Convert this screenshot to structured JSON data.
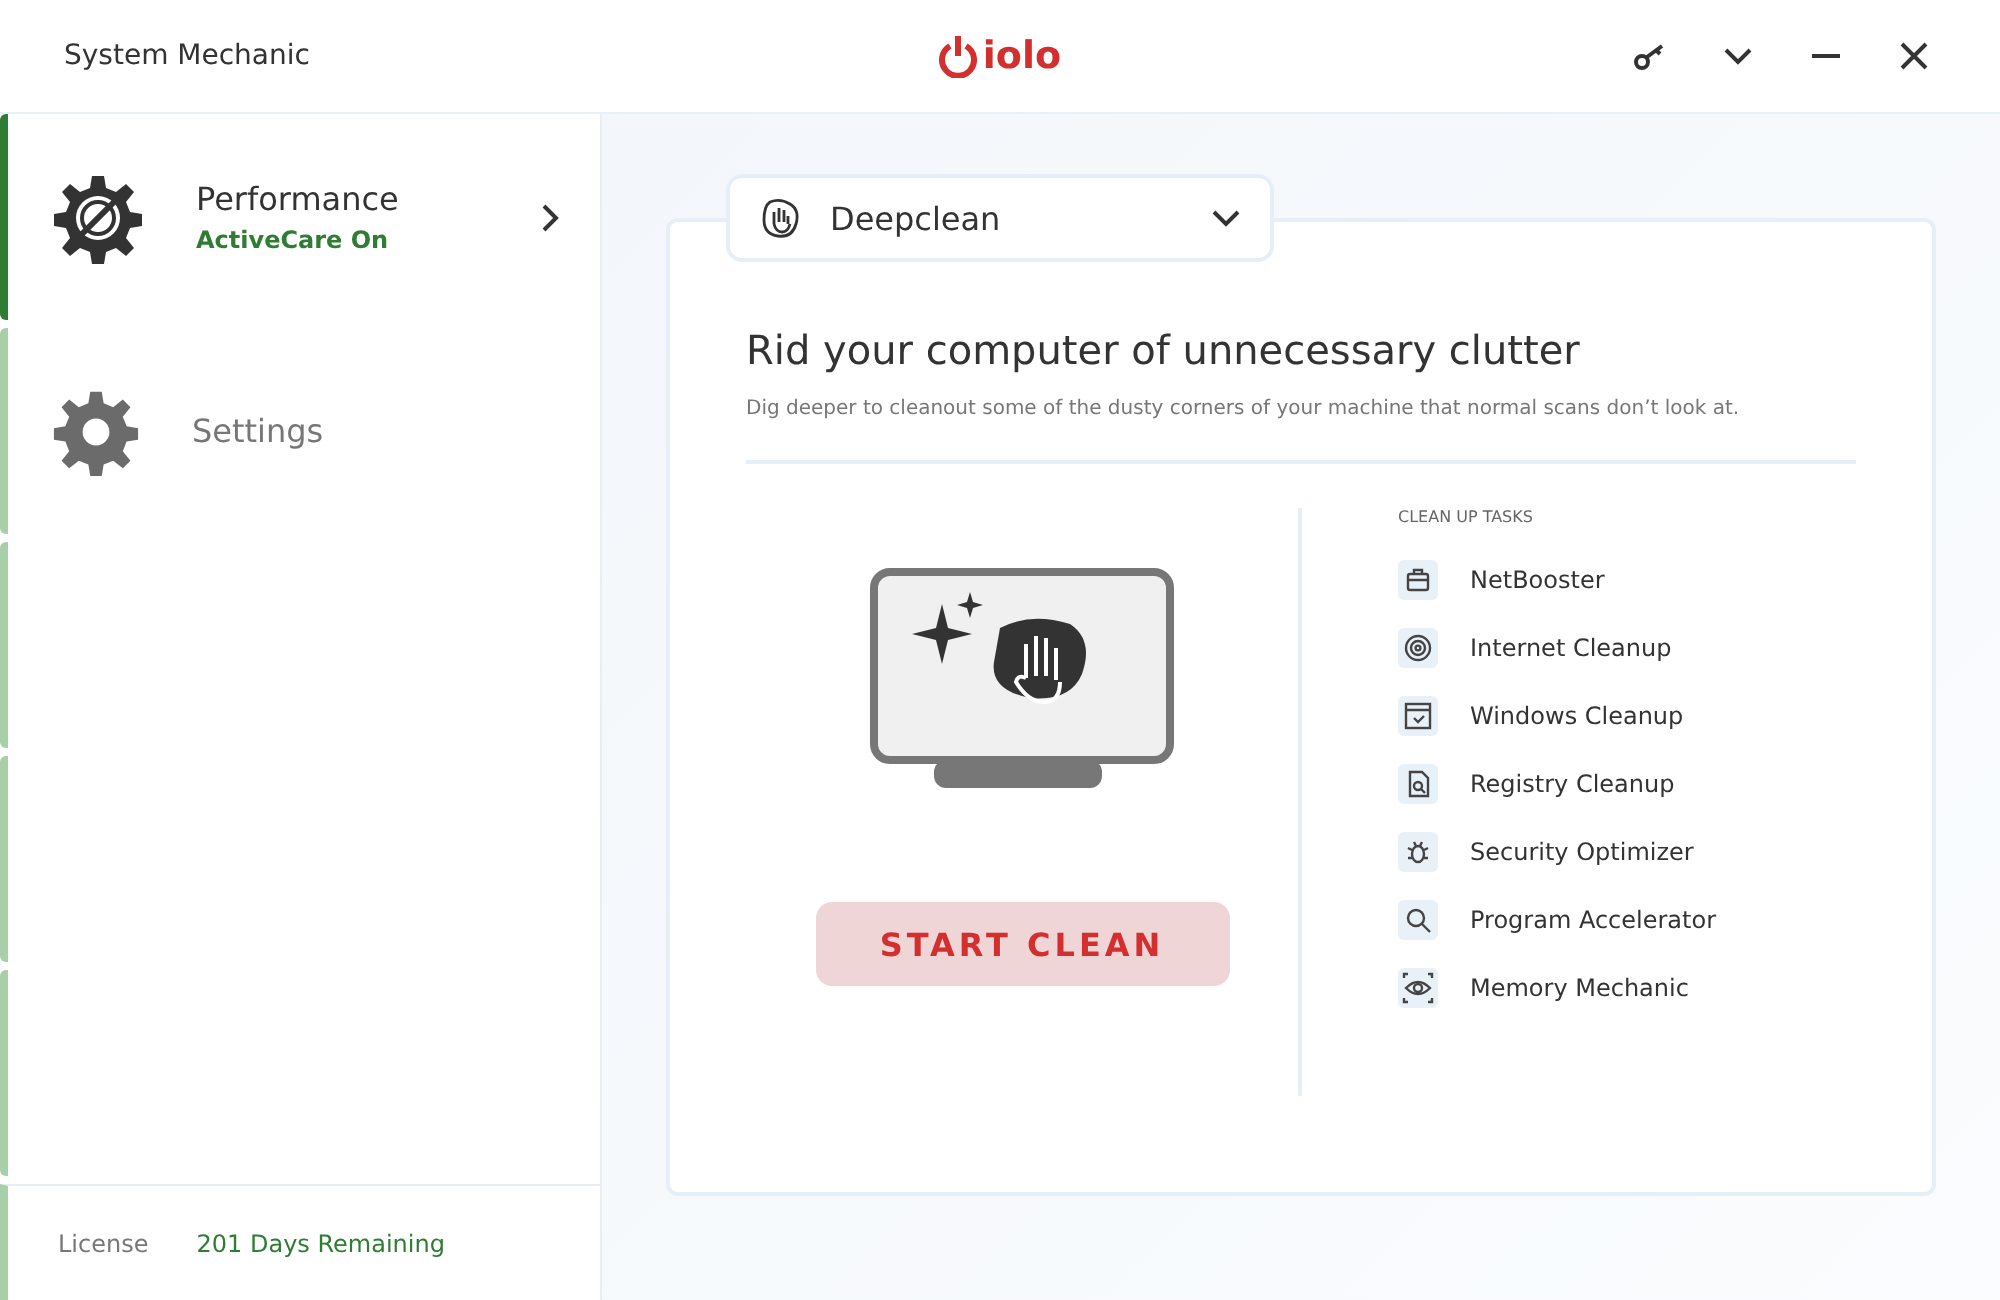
{
  "window": {
    "title": "System Mechanic",
    "logo": "iolo"
  },
  "sidebar": {
    "items": [
      {
        "kind": "performance",
        "label": "Performance",
        "status": "ActiveCare On",
        "selected": true
      },
      {
        "kind": "settings",
        "label": "Settings",
        "selected": false
      }
    ],
    "license_label": "License",
    "license_value": "201 Days Remaining"
  },
  "mode_select": {
    "value": "Deepclean"
  },
  "panel": {
    "title": "Rid your computer of unnecessary clutter",
    "subtitle": "Dig deeper to cleanout some of the dusty corners of your machine that normal scans don’t look at.",
    "button": "START CLEAN",
    "tasks_heading": "CLEAN UP TASKS",
    "tasks": [
      {
        "kind": "briefcase",
        "label": "NetBooster"
      },
      {
        "kind": "target",
        "label": "Internet Cleanup"
      },
      {
        "kind": "window",
        "label": "Windows Cleanup"
      },
      {
        "kind": "document",
        "label": "Registry Cleanup"
      },
      {
        "kind": "bug",
        "label": "Security Optimizer"
      },
      {
        "kind": "search",
        "label": "Program Accelerator"
      },
      {
        "kind": "eye",
        "label": "Memory Mechanic"
      }
    ]
  }
}
